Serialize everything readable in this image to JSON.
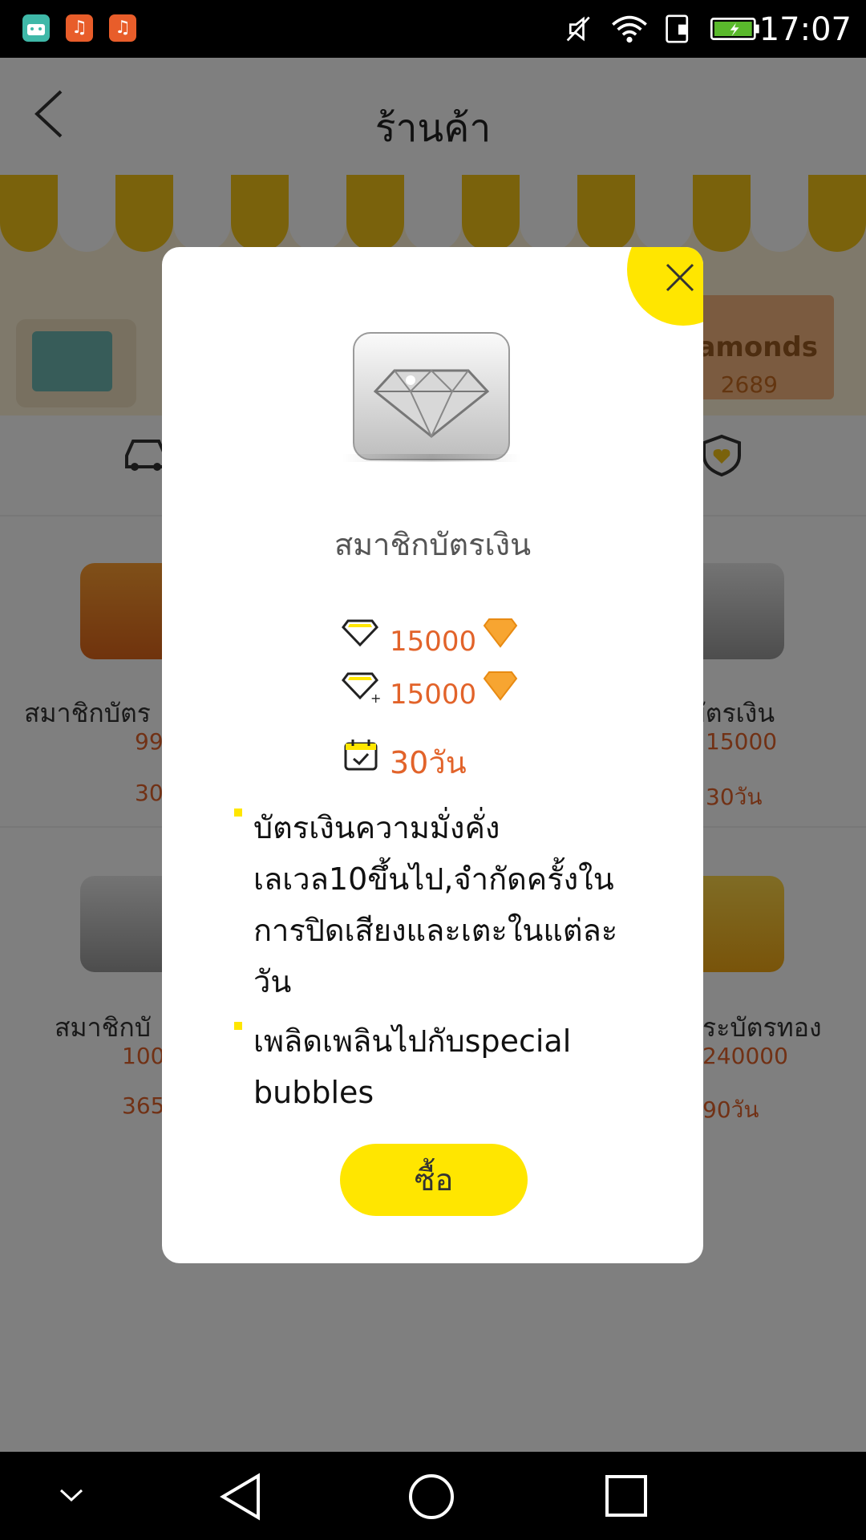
{
  "status_bar": {
    "time": "17:07"
  },
  "header": {
    "title": "ร้านค้า"
  },
  "banner": {
    "title": "Diamonds",
    "count": "2689"
  },
  "cards": [
    {
      "name": "สมาชิกบัตร",
      "price": "99",
      "days": "30"
    },
    {
      "name": "กบัตรเงิน",
      "price": "15000",
      "days": "30วัน"
    },
    {
      "name": "สมาชิกบั",
      "price": "100",
      "days": "365"
    },
    {
      "name": "ระบัตรทอง",
      "price": "240000",
      "days": "90วัน"
    }
  ],
  "dialog": {
    "title": "สมาชิกบัตรเงิน",
    "price1": "15000",
    "price2": "15000",
    "days": "30วัน",
    "bullets": [
      "บัตรเงินความมั่งคั่งเลเวล10ขึ้นไป,จำกัดครั้งในการปิดเสียงและเตะในแต่ละวัน",
      "เพลิดเพลินไปกับspecial bubbles"
    ],
    "buy_label": "ซื้อ"
  }
}
